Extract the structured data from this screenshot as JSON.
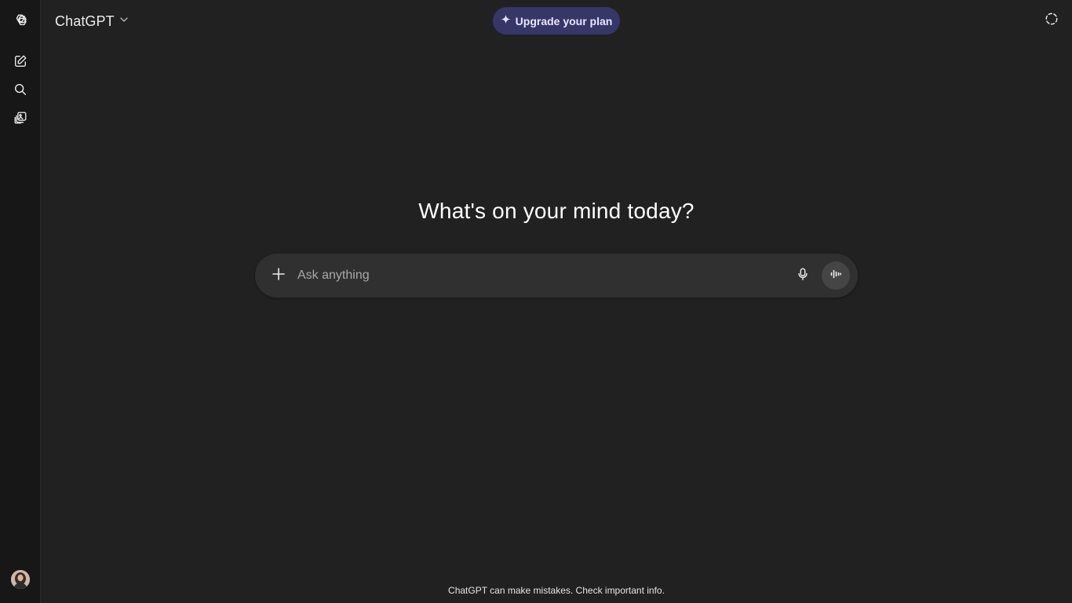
{
  "app": {
    "model_label": "ChatGPT",
    "upgrade_label": "Upgrade your plan"
  },
  "sidebar": {
    "icons": [
      "openai-logo-icon",
      "new-chat-icon",
      "search-icon",
      "library-icon"
    ],
    "avatar": "user-avatar"
  },
  "main": {
    "heading": "What's on your mind today?",
    "composer": {
      "placeholder": "Ask anything"
    },
    "disclaimer": "ChatGPT can make mistakes. Check important info."
  },
  "colors": {
    "background": "#212121",
    "sidebar": "#171717",
    "composer": "#303030",
    "upgrade_button": "#373669",
    "voice_button": "#454545"
  }
}
